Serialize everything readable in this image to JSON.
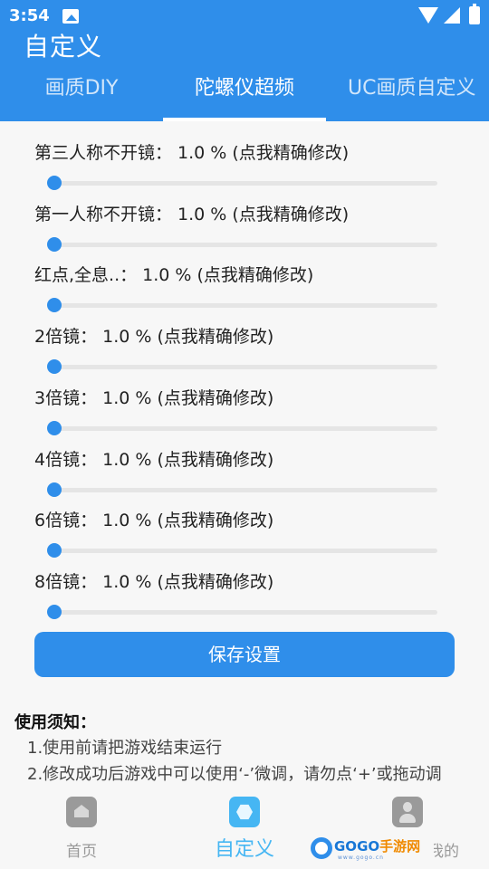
{
  "status_bar": {
    "time": "3:54"
  },
  "app": {
    "title": "自定义"
  },
  "tabs": [
    {
      "label": "画质DIY"
    },
    {
      "label": "陀螺仪超频"
    },
    {
      "label": "UC画质自定义"
    }
  ],
  "settings": [
    {
      "label": "第三人称不开镜：  1.0 %  (点我精确修改)",
      "value_percent": 1.0
    },
    {
      "label": "第一人称不开镜：  1.0 %  (点我精确修改)",
      "value_percent": 1.0
    },
    {
      "label": "红点,全息..：  1.0 %  (点我精确修改)",
      "value_percent": 1.0
    },
    {
      "label": "2倍镜：  1.0 %  (点我精确修改)",
      "value_percent": 1.0
    },
    {
      "label": "3倍镜：  1.0 %  (点我精确修改)",
      "value_percent": 1.0
    },
    {
      "label": "4倍镜：  1.0 %  (点我精确修改)",
      "value_percent": 1.0
    },
    {
      "label": "6倍镜：  1.0 %  (点我精确修改)",
      "value_percent": 1.0
    },
    {
      "label": "8倍镜：  1.0 %  (点我精确修改)",
      "value_percent": 1.0
    }
  ],
  "save_button": {
    "label": "保存设置"
  },
  "notice": {
    "title": "使用须知：",
    "lines": [
      "1.使用前请把游戏结束运行",
      "2.修改成功后游戏中可以使用‘-’微调，请勿点‘+’或拖动调"
    ]
  },
  "bottom_nav": [
    {
      "label": "首页"
    },
    {
      "label": "自定义"
    },
    {
      "label": "我的"
    }
  ],
  "watermark": {
    "brand_a": "GOGO",
    "brand_b": "手游网",
    "url": "www.gogo.cn"
  },
  "colors": {
    "primary": "#2f8eea",
    "active_nav": "#46b6f3"
  }
}
